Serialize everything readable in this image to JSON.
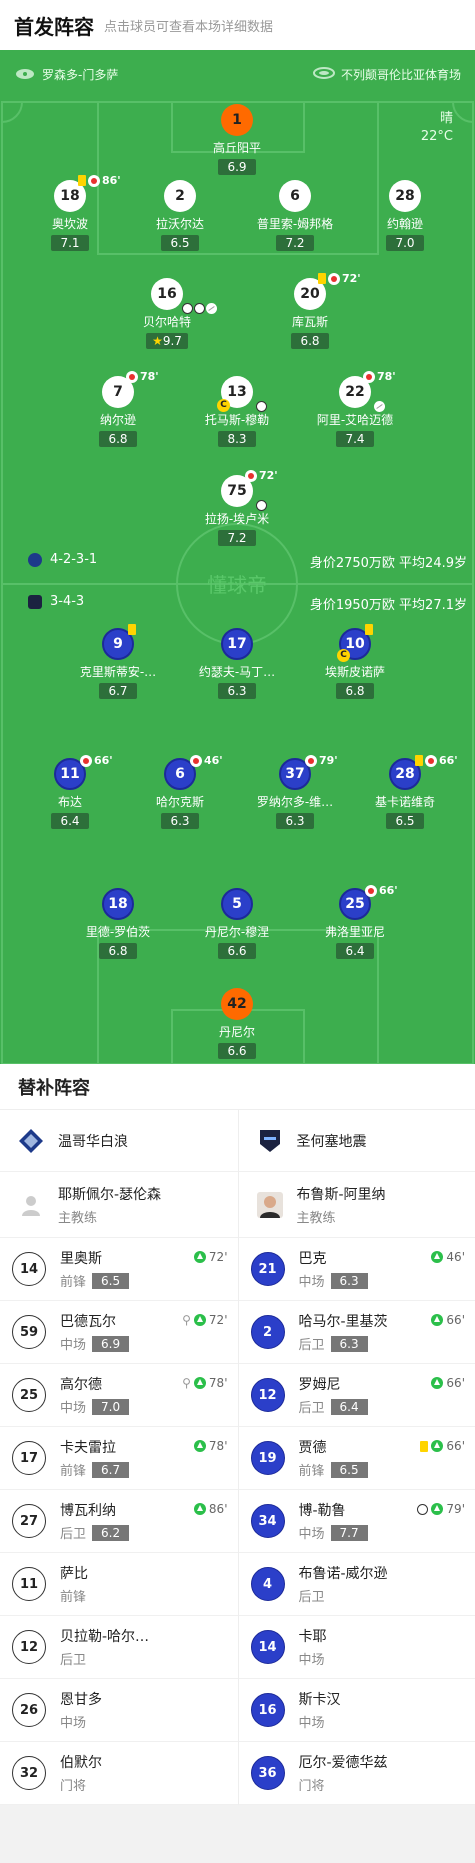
{
  "header": {
    "title": "首发阵容",
    "subtitle": "点击球员可查看本场详细数据"
  },
  "match": {
    "referee": "罗森多-门多萨",
    "stadium": "不列颠哥伦比亚体育场",
    "weather": "晴",
    "temperature": "22°C",
    "watermark": "懂球帝"
  },
  "home": {
    "name": "温哥华白浪",
    "formation": "4-2-3-1",
    "value_age": "身价2750万欧 平均24.9岁",
    "coach": "耶斯佩尔-瑟伦森",
    "coach_role": "主教练",
    "color": "#ffffff",
    "players": [
      {
        "num": "1",
        "name": "高丘阳平",
        "rating": "6.9",
        "gk": true
      },
      {
        "num": "18",
        "name": "奥坎波",
        "rating": "7.1",
        "yellow": true,
        "sub": "86'"
      },
      {
        "num": "2",
        "name": "拉沃尔达",
        "rating": "6.5"
      },
      {
        "num": "6",
        "name": "普里索-姆邦格",
        "rating": "7.2"
      },
      {
        "num": "28",
        "name": "约翰逊",
        "rating": "7.0"
      },
      {
        "num": "16",
        "name": "贝尔哈特",
        "rating": "9.7",
        "star": true
      },
      {
        "num": "20",
        "name": "库瓦斯",
        "rating": "6.8",
        "yellow": true,
        "sub": "72'"
      },
      {
        "num": "7",
        "name": "纳尔逊",
        "rating": "6.8",
        "sub": "78'"
      },
      {
        "num": "13",
        "name": "托马斯-穆勒",
        "rating": "8.3",
        "captain": true
      },
      {
        "num": "22",
        "name": "阿里-艾哈迈德",
        "rating": "7.4",
        "sub": "78'"
      },
      {
        "num": "75",
        "name": "拉扬-埃卢米",
        "rating": "7.2",
        "sub": "72'"
      }
    ]
  },
  "away": {
    "name": "圣何塞地震",
    "formation": "3-4-3",
    "value_age": "身价1950万欧 平均27.1岁",
    "coach": "布鲁斯-阿里纳",
    "coach_role": "主教练",
    "color": "#2b3fc9",
    "players": [
      {
        "num": "9",
        "name": "克里斯蒂安-…",
        "rating": "6.7",
        "yellow": true
      },
      {
        "num": "17",
        "name": "约瑟夫-马丁…",
        "rating": "6.3"
      },
      {
        "num": "10",
        "name": "埃斯皮诺萨",
        "rating": "6.8",
        "yellow": true,
        "captain": true
      },
      {
        "num": "11",
        "name": "布达",
        "rating": "6.4",
        "sub": "66'"
      },
      {
        "num": "6",
        "name": "哈尔克斯",
        "rating": "6.3",
        "sub": "46'"
      },
      {
        "num": "37",
        "name": "罗纳尔多-维…",
        "rating": "6.3",
        "sub": "79'"
      },
      {
        "num": "28",
        "name": "基卡诺维奇",
        "rating": "6.5",
        "yellow": true,
        "sub": "66'"
      },
      {
        "num": "18",
        "name": "里德-罗伯茨",
        "rating": "6.8"
      },
      {
        "num": "5",
        "name": "丹尼尔-穆涅",
        "rating": "6.6"
      },
      {
        "num": "25",
        "name": "弗洛里亚尼",
        "rating": "6.4",
        "sub": "66'"
      },
      {
        "num": "42",
        "name": "丹尼尔",
        "rating": "6.6",
        "gk": true
      }
    ]
  },
  "subs": {
    "title": "替补阵容",
    "home": [
      {
        "num": "14",
        "name": "里奥斯",
        "pos": "前锋",
        "rating": "6.5",
        "time": "72'"
      },
      {
        "num": "59",
        "name": "巴德瓦尔",
        "pos": "中场",
        "rating": "6.9",
        "time": "72'",
        "assist": true
      },
      {
        "num": "25",
        "name": "高尔德",
        "pos": "中场",
        "rating": "7.0",
        "time": "78'",
        "assist": true
      },
      {
        "num": "17",
        "name": "卡夫雷拉",
        "pos": "前锋",
        "rating": "6.7",
        "time": "78'"
      },
      {
        "num": "27",
        "name": "博瓦利纳",
        "pos": "后卫",
        "rating": "6.2",
        "time": "86'"
      },
      {
        "num": "11",
        "name": "萨比",
        "pos": "前锋"
      },
      {
        "num": "12",
        "name": "贝拉勒-哈尔…",
        "pos": "后卫"
      },
      {
        "num": "26",
        "name": "恩甘多",
        "pos": "中场"
      },
      {
        "num": "32",
        "name": "伯默尔",
        "pos": "门将"
      }
    ],
    "away": [
      {
        "num": "21",
        "name": "巴克",
        "pos": "中场",
        "rating": "6.3",
        "time": "46'"
      },
      {
        "num": "2",
        "name": "哈马尔-里基茨",
        "pos": "后卫",
        "rating": "6.3",
        "time": "66'"
      },
      {
        "num": "12",
        "name": "罗姆尼",
        "pos": "后卫",
        "rating": "6.4",
        "time": "66'"
      },
      {
        "num": "19",
        "name": "贾德",
        "pos": "前锋",
        "rating": "6.5",
        "time": "66'",
        "yellow": true
      },
      {
        "num": "34",
        "name": "博-勒鲁",
        "pos": "中场",
        "rating": "7.7",
        "time": "79'",
        "goal": true
      },
      {
        "num": "4",
        "name": "布鲁诺-威尔逊",
        "pos": "后卫"
      },
      {
        "num": "14",
        "name": "卡耶",
        "pos": "中场"
      },
      {
        "num": "16",
        "name": "斯卡汉",
        "pos": "中场"
      },
      {
        "num": "36",
        "name": "厄尔-爱德华兹",
        "pos": "门将"
      }
    ]
  }
}
